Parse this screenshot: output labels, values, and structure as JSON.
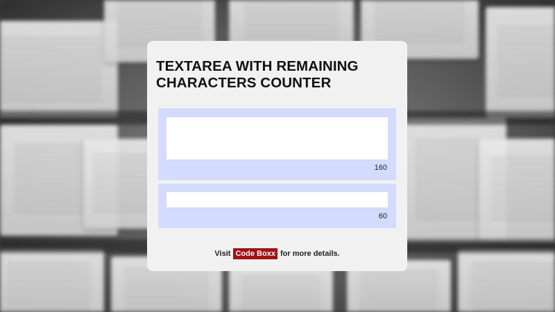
{
  "page": {
    "title": "TEXTAREA WITH REMAINING CHARACTERS COUNTER"
  },
  "form": {
    "textarea": {
      "value": "",
      "counter": "160"
    },
    "text_input": {
      "value": "",
      "counter": "60"
    }
  },
  "footer": {
    "prefix": "Visit",
    "link_label": "Code Boxx",
    "suffix": "for more details."
  },
  "colors": {
    "card_bg": "#f1f1f1",
    "panel_bg": "#d3dcff",
    "link_bg": "#a21212",
    "link_text": "#ffffff"
  }
}
